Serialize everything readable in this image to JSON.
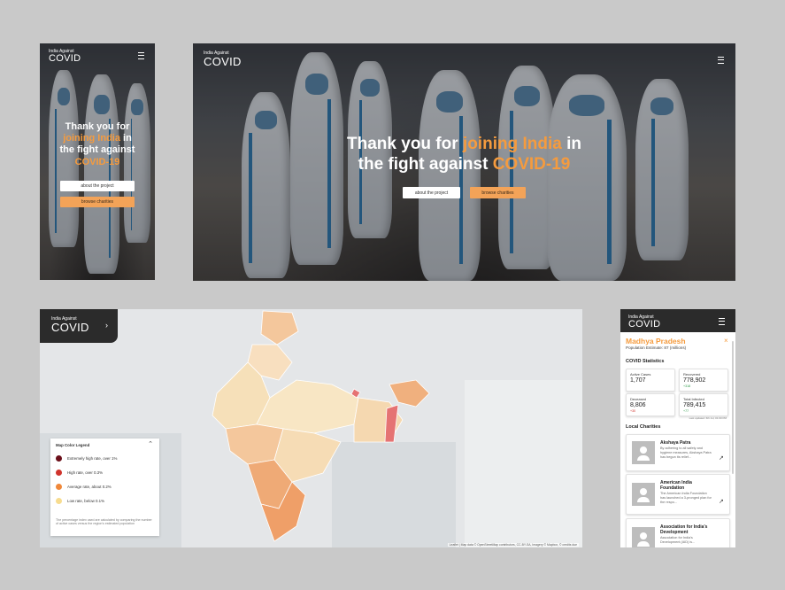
{
  "brand": {
    "small": "India Against",
    "big": "COVID"
  },
  "hero": {
    "line1_pre": "Thank you for",
    "line1_hl": "joining India",
    "line1_post": "in",
    "line2_pre": "the fight against",
    "line2_hl": "COVID-19",
    "btn_about": "about the project",
    "btn_charities": "browse charities"
  },
  "mobile_hero": {
    "l1": "Thank you for",
    "l2_hl": "joining India",
    "l2_post": "in",
    "l3": "the fight against",
    "l4_hl": "COVID-19"
  },
  "map": {
    "legend_title": "Map Color Legend",
    "legend_items": [
      {
        "label": "Extremely high rate, over 1%",
        "color": "#6b0f1a"
      },
      {
        "label": "High rate, over 0.3%",
        "color": "#d0342c"
      },
      {
        "label": "Average rate, about 0.2%",
        "color": "#f0883a"
      },
      {
        "label": "Low rate, below 0.1%",
        "color": "#f7dc8f"
      }
    ],
    "legend_note": "The percentage index used are calculated by comparing the number of active cases versus the region's estimated population",
    "attribution": "Leaflet | Map data © OpenStreetMap contributors, CC-BY-SA, Imagery © Mapbox, © credits due"
  },
  "side": {
    "state": "Madhya Pradesh",
    "population": "Population Estimate: 87 (millions)",
    "stats_title": "COVID Statistics",
    "stats": [
      {
        "label": "Active Cases",
        "value": "1,707",
        "delta": ""
      },
      {
        "label": "Recovered",
        "value": "778,902",
        "delta": "+318",
        "delta_color": "#2e9c4a"
      },
      {
        "label": "Deceased",
        "value": "8,806",
        "delta": "+30",
        "delta_color": "#d0342c"
      },
      {
        "label": "Total Infected",
        "value": "789,415",
        "delta": "+77",
        "delta_color": "#2e9c4a"
      }
    ],
    "updated": "Last updated: 6th Jul, 01:00 PM",
    "charities_title": "Local Charities",
    "charities": [
      {
        "name": "Akshaya Patra",
        "desc": "By adhering to all safety and hygiene measures, Akshaya Patra has begun its relief..."
      },
      {
        "name": "American India Foundation",
        "desc": "The American India Foundation has launched a 3-pronged plan for the respo..."
      },
      {
        "name": "Association for India's Development",
        "desc": "Association for India's Development (AID) is..."
      }
    ]
  },
  "colors": {
    "accent": "#f59b3e",
    "dark": "#2b2b2b"
  }
}
